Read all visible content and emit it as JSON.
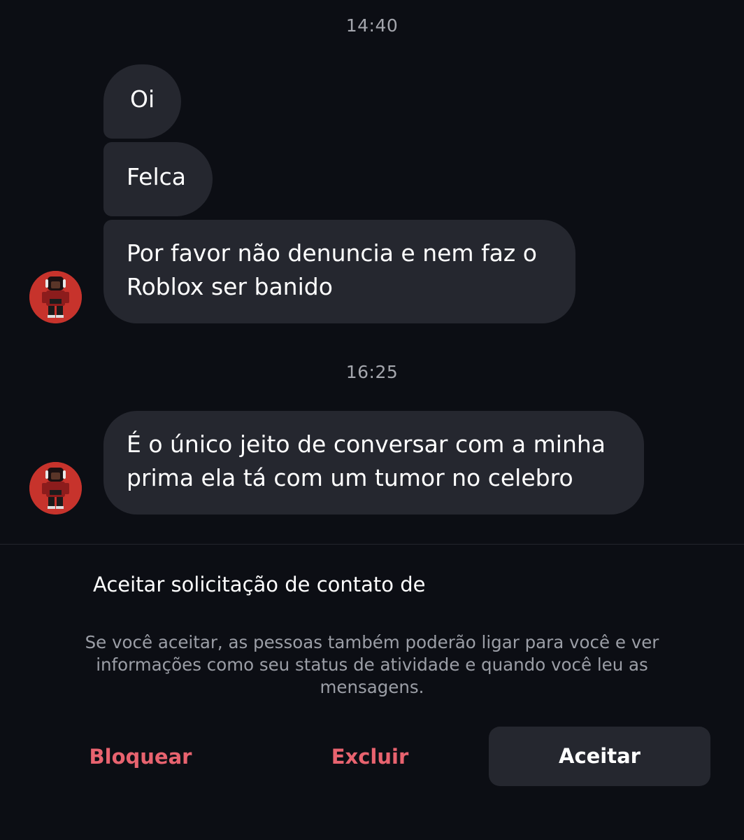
{
  "conversation": {
    "timestamps": [
      "14:40",
      "16:25"
    ],
    "messages": [
      {
        "text": "Oi"
      },
      {
        "text": "Felca"
      },
      {
        "lines": [
          "Por favor não denuncia e nem faz o",
          "Roblox ser banido"
        ]
      },
      {
        "lines": [
          "É o único jeito de conversar com a minha",
          "prima ela tá com um tumor no celebro"
        ]
      }
    ],
    "avatar_icon": "roblox-character-avatar"
  },
  "request": {
    "title": "Aceitar solicitação de contato de",
    "description": "Se você aceitar, as pessoas também poderão ligar para você e ver informações como seu status de atividade e quando você leu as mensagens."
  },
  "actions": {
    "block_label": "Bloquear",
    "delete_label": "Excluir",
    "accept_label": "Aceitar"
  },
  "colors": {
    "background": "#0c0e14",
    "bubble": "#25272f",
    "danger": "#e8636f",
    "muted": "#9b9ea6",
    "avatar_bg": "#c7332c"
  }
}
